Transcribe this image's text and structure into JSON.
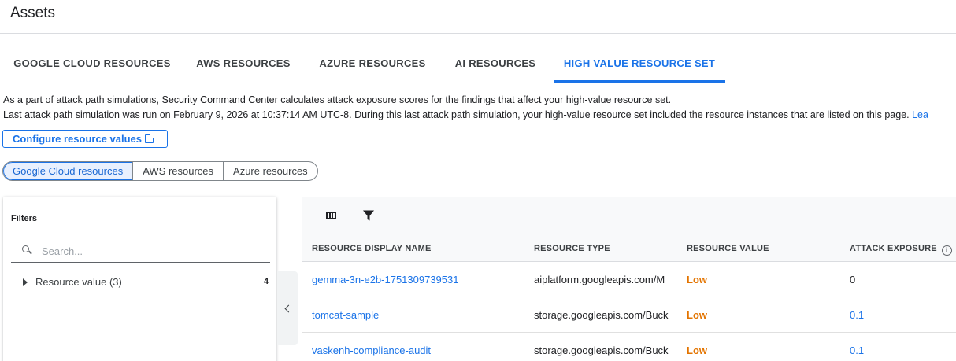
{
  "page": {
    "title": "Assets"
  },
  "tabs": [
    {
      "label": "GOOGLE CLOUD RESOURCES",
      "active": false
    },
    {
      "label": "AWS RESOURCES",
      "active": false
    },
    {
      "label": "AZURE RESOURCES",
      "active": false
    },
    {
      "label": "AI RESOURCES",
      "active": false
    },
    {
      "label": "HIGH VALUE RESOURCE SET",
      "active": true
    }
  ],
  "description": {
    "line1": "As a part of attack path simulations, Security Command Center calculates attack exposure scores for the findings that affect your high-value resource set.",
    "line2": "Last attack path simulation was run on February 9, 2026 at 10:37:14 AM UTC-8. During this last attack path simulation, your high-value resource set included the resource instances that are listed on this page.",
    "learn_more": "Lea"
  },
  "configure_button": {
    "label": "Configure resource values",
    "icon": "open-in-new-icon"
  },
  "segments": [
    {
      "label": "Google Cloud resources",
      "active": true
    },
    {
      "label": "AWS resources",
      "active": false
    },
    {
      "label": "Azure resources",
      "active": false
    }
  ],
  "filters": {
    "title": "Filters",
    "search_placeholder": "Search...",
    "items": [
      {
        "label": "Resource value (3)",
        "count": "4"
      }
    ]
  },
  "table": {
    "toolbar_icons": [
      "column-display-icon",
      "filter-icon"
    ],
    "columns": [
      "RESOURCE DISPLAY NAME",
      "RESOURCE TYPE",
      "RESOURCE VALUE",
      "ATTACK EXPOSURE"
    ],
    "rows": [
      {
        "name": "gemma-3n-e2b-1751309739531",
        "type": "aiplatform.googleapis.com/M",
        "value": "Low",
        "exposure": "0"
      },
      {
        "name": "tomcat-sample",
        "type": "storage.googleapis.com/Buck",
        "value": "Low",
        "exposure": "0.1"
      },
      {
        "name": "vaskenh-compliance-audit",
        "type": "storage.googleapis.com/Buck",
        "value": "Low",
        "exposure": "0.1"
      }
    ]
  },
  "colors": {
    "accent": "#1a73e8",
    "low_value": "#e37400",
    "text": "#202124"
  }
}
